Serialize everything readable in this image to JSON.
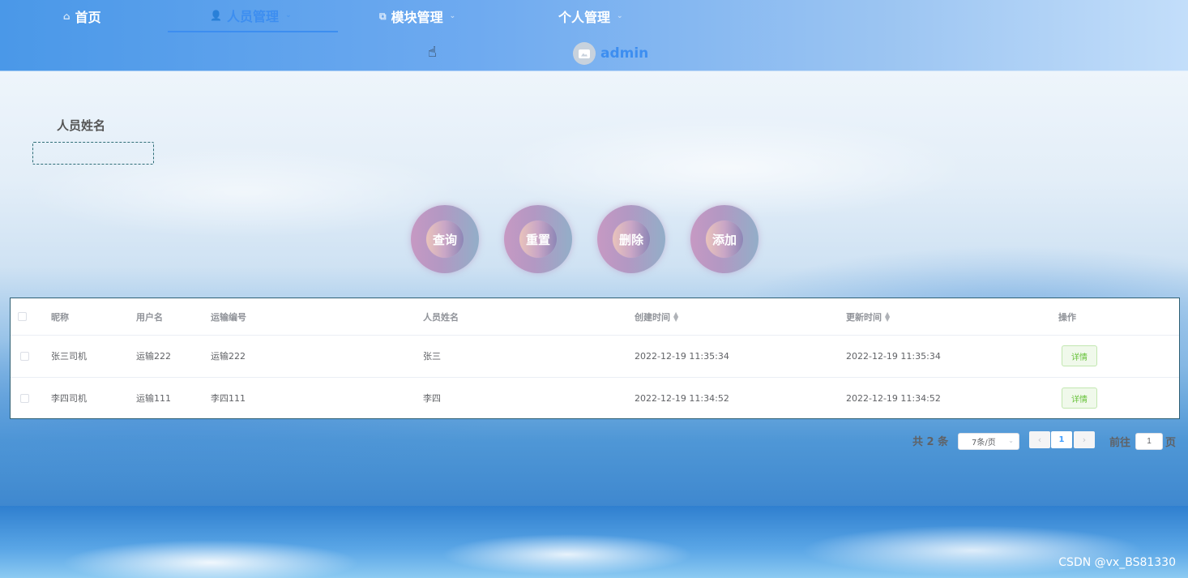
{
  "nav": {
    "items": [
      {
        "label": "首页",
        "icon": "home-icon"
      },
      {
        "label": "人员管理",
        "icon": "user-icon",
        "active": true
      },
      {
        "label": "模块管理",
        "icon": "copy-icon"
      },
      {
        "label": "个人管理"
      }
    ],
    "username": "admin"
  },
  "search": {
    "label": "人员姓名",
    "value": "",
    "placeholder": ""
  },
  "buttons": {
    "query": "查询",
    "reset": "重置",
    "delete": "删除",
    "add": "添加"
  },
  "table": {
    "headers": [
      "昵称",
      "用户名",
      "运输编号",
      "人员姓名",
      "创建时间",
      "更新时间",
      "操作"
    ],
    "rows": [
      {
        "nickname": "张三司机",
        "username": "运输222",
        "transport_no": "运输222",
        "name": "张三",
        "created": "2022-12-19 11:35:34",
        "updated": "2022-12-19 11:35:34",
        "action": "详情"
      },
      {
        "nickname": "李四司机",
        "username": "运输111",
        "transport_no": "李四111",
        "name": "李四",
        "created": "2022-12-19 11:34:52",
        "updated": "2022-12-19 11:34:52",
        "action": "详情"
      }
    ]
  },
  "pagination": {
    "total_text": "共 2 条",
    "page_size": "7条/页",
    "current_page": "1",
    "goto_prefix": "前往",
    "goto_value": "1",
    "goto_suffix": "页"
  },
  "watermark": "CSDN @vx_BS81330",
  "colors": {
    "accent": "#3d8ef0",
    "table_border": "#2e5f74",
    "detail_green": "#67c23a"
  }
}
